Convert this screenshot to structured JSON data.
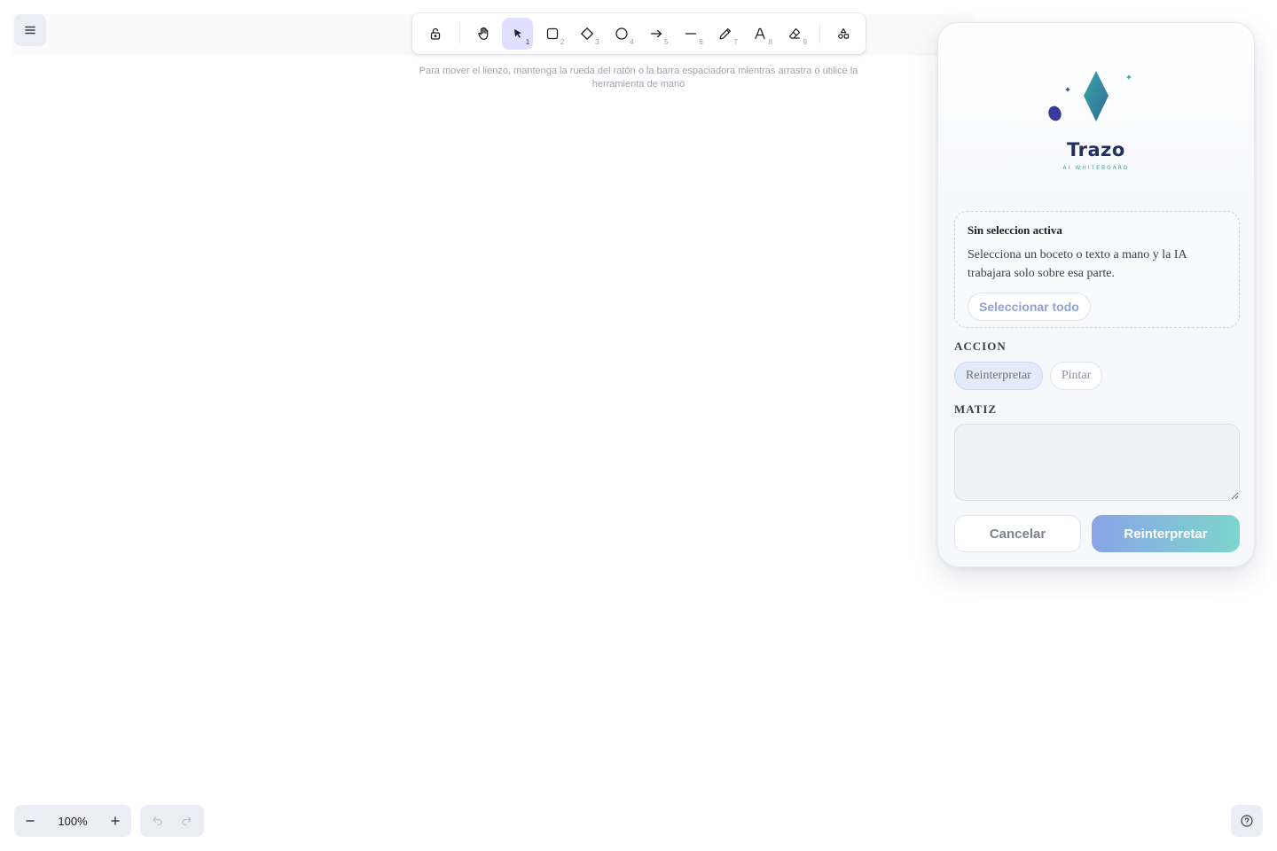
{
  "toolbar": {
    "tools": [
      {
        "name": "lock",
        "num": ""
      },
      {
        "name": "hand",
        "num": ""
      },
      {
        "name": "selection",
        "num": "1"
      },
      {
        "name": "rectangle",
        "num": "2"
      },
      {
        "name": "diamond",
        "num": "3"
      },
      {
        "name": "ellipse",
        "num": "4"
      },
      {
        "name": "arrow",
        "num": "5"
      },
      {
        "name": "line",
        "num": "6"
      },
      {
        "name": "pencil",
        "num": "7"
      },
      {
        "name": "text",
        "num": "8"
      },
      {
        "name": "eraser",
        "num": "9"
      },
      {
        "name": "more-shapes",
        "num": ""
      }
    ],
    "active_tool": "selection"
  },
  "hint": "Para mover el lienzo, mantenga la rueda del ratón o la barra espaciadora mientras arrastra o utilice la herramienta de mano",
  "zoom": {
    "value": "100%"
  },
  "panel": {
    "brand_name": "Trazo",
    "brand_tagline": "AI WHITEBOARD",
    "selection": {
      "title": "Sin seleccion activa",
      "description": "Selecciona un boceto o texto a mano y la IA trabajara solo sobre esa parte.",
      "select_all_label": "Seleccionar todo"
    },
    "action_label": "ACCION",
    "actions": [
      "Reinterpretar",
      "Pintar"
    ],
    "active_action": "Reinterpretar",
    "hue_label": "MATIZ",
    "hue_value": "",
    "hue_placeholder": "",
    "cancel_label": "Cancelar",
    "submit_label": "Reinterpretar"
  },
  "colors": {
    "accent": "#e0dfff",
    "brand_dark": "#1f2f5e",
    "brand_teal": "#3fa4a4",
    "brand_gradient_start": "#8aa4e8",
    "brand_gradient_end": "#7cd6cc"
  }
}
